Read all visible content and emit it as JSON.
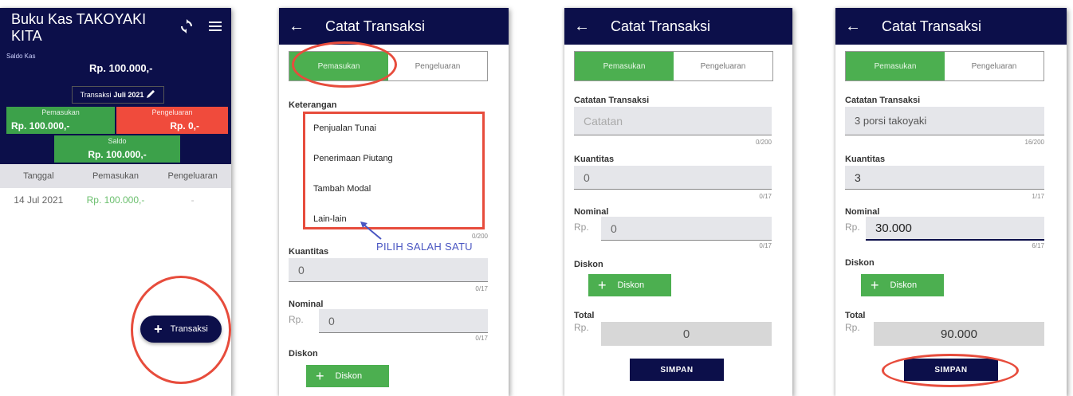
{
  "screen1": {
    "app_title": "Buku Kas TAKOYAKI KITA",
    "sync_icon": "sync-icon",
    "menu_icon": "hamburger-menu-icon",
    "saldo_kas_label": "Saldo Kas",
    "saldo_kas_value": "Rp. 100.000,-",
    "period_prefix": "Transaksi",
    "period_value": "Juli 2021",
    "pemasukan_label": "Pemasukan",
    "pemasukan_value": "Rp. 100.000,-",
    "pengeluaran_label": "Pengeluaran",
    "pengeluaran_value": "Rp. 0,-",
    "saldo_label": "Saldo",
    "saldo_value": "Rp. 100.000,-",
    "table_headers": [
      "Tanggal",
      "Pemasukan",
      "Pengeluaran"
    ],
    "table_rows": [
      {
        "tanggal": "14 Jul 2021",
        "pemasukan": "Rp. 100.000,-",
        "pengeluaran": "-"
      }
    ],
    "fab_label": "Transaksi"
  },
  "screen2": {
    "title": "Catat Transaksi",
    "tab_in": "Pemasukan",
    "tab_out": "Pengeluaran",
    "keterangan_label": "Keterangan",
    "options": [
      "Penjualan Tunai",
      "Penerimaan Piutang",
      "Tambah Modal",
      "Lain-lain"
    ],
    "hint": "PILIH SALAH SATU",
    "hidden_counter": "0/200",
    "kuantitas_label": "Kuantitas",
    "kuantitas_value": "0",
    "kuantitas_counter": "0/17",
    "nominal_label": "Nominal",
    "rp": "Rp.",
    "nominal_value": "0",
    "nominal_counter": "0/17",
    "diskon_label": "Diskon",
    "diskon_button": "Diskon"
  },
  "screen3": {
    "title": "Catat Transaksi",
    "tab_in": "Pemasukan",
    "tab_out": "Pengeluaran",
    "catatan_label": "Catatan Transaksi",
    "catatan_placeholder": "Catatan",
    "catatan_counter": "0/200",
    "kuantitas_label": "Kuantitas",
    "kuantitas_value": "0",
    "kuantitas_counter": "0/17",
    "nominal_label": "Nominal",
    "rp": "Rp.",
    "nominal_value": "0",
    "nominal_counter": "0/17",
    "diskon_label": "Diskon",
    "diskon_button": "Diskon",
    "total_label": "Total",
    "total_rp": "Rp.",
    "total_value": "0",
    "simpan": "SIMPAN"
  },
  "screen4": {
    "title": "Catat Transaksi",
    "tab_in": "Pemasukan",
    "tab_out": "Pengeluaran",
    "catatan_label": "Catatan Transaksi",
    "catatan_value": "3 porsi takoyaki",
    "catatan_counter": "16/200",
    "kuantitas_label": "Kuantitas",
    "kuantitas_value": "3",
    "kuantitas_counter": "1/17",
    "nominal_label": "Nominal",
    "rp": "Rp.",
    "nominal_value": "30.000",
    "nominal_counter": "6/17",
    "diskon_label": "Diskon",
    "diskon_button": "Diskon",
    "total_label": "Total",
    "total_rp": "Rp.",
    "total_value": "90.000",
    "simpan": "SIMPAN"
  },
  "colors": {
    "navy": "#0c0f4a",
    "green": "#4caf50",
    "red": "#f04b3c",
    "highlight": "#e74c3c"
  }
}
